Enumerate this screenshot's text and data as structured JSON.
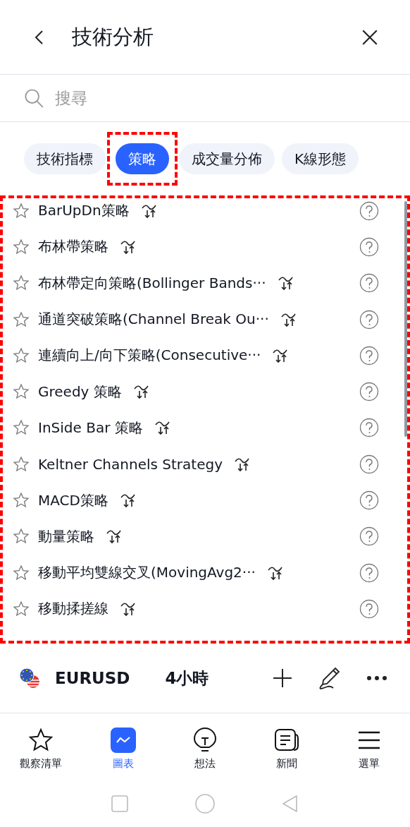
{
  "header": {
    "title": "技術分析"
  },
  "search": {
    "placeholder": "搜尋"
  },
  "categories": [
    {
      "label": "技術指標",
      "selected": false,
      "annotated": false
    },
    {
      "label": "策略",
      "selected": true,
      "annotated": true
    },
    {
      "label": "成交量分佈",
      "selected": false,
      "annotated": false
    },
    {
      "label": "K線形態",
      "selected": false,
      "annotated": false
    }
  ],
  "list": {
    "annotated": true,
    "items": [
      {
        "name": "BarUpDn策略",
        "favorite": false
      },
      {
        "name": "布林帶策略",
        "favorite": false
      },
      {
        "name": "布林帶定向策略(Bollinger Bands···",
        "favorite": false
      },
      {
        "name": "通道突破策略(Channel Break Ou···",
        "favorite": false
      },
      {
        "name": "連續向上/向下策略(Consecutive···",
        "favorite": false
      },
      {
        "name": "Greedy 策略",
        "favorite": false
      },
      {
        "name": "InSide Bar 策略",
        "favorite": false
      },
      {
        "name": "Keltner Channels Strategy",
        "favorite": false
      },
      {
        "name": "MACD策略",
        "favorite": false
      },
      {
        "name": "動量策略",
        "favorite": false
      },
      {
        "name": "移動平均雙線交叉(MovingAvg2···",
        "favorite": false
      },
      {
        "name": "移動揉搓線",
        "favorite": false
      }
    ]
  },
  "symbol_bar": {
    "symbol": "EURUSD",
    "interval": "4小時"
  },
  "bottom_nav": [
    {
      "label": "觀察清單",
      "selected": false
    },
    {
      "label": "圖表",
      "selected": true
    },
    {
      "label": "想法",
      "selected": false
    },
    {
      "label": "新聞",
      "selected": false
    },
    {
      "label": "選單",
      "selected": false
    }
  ]
}
